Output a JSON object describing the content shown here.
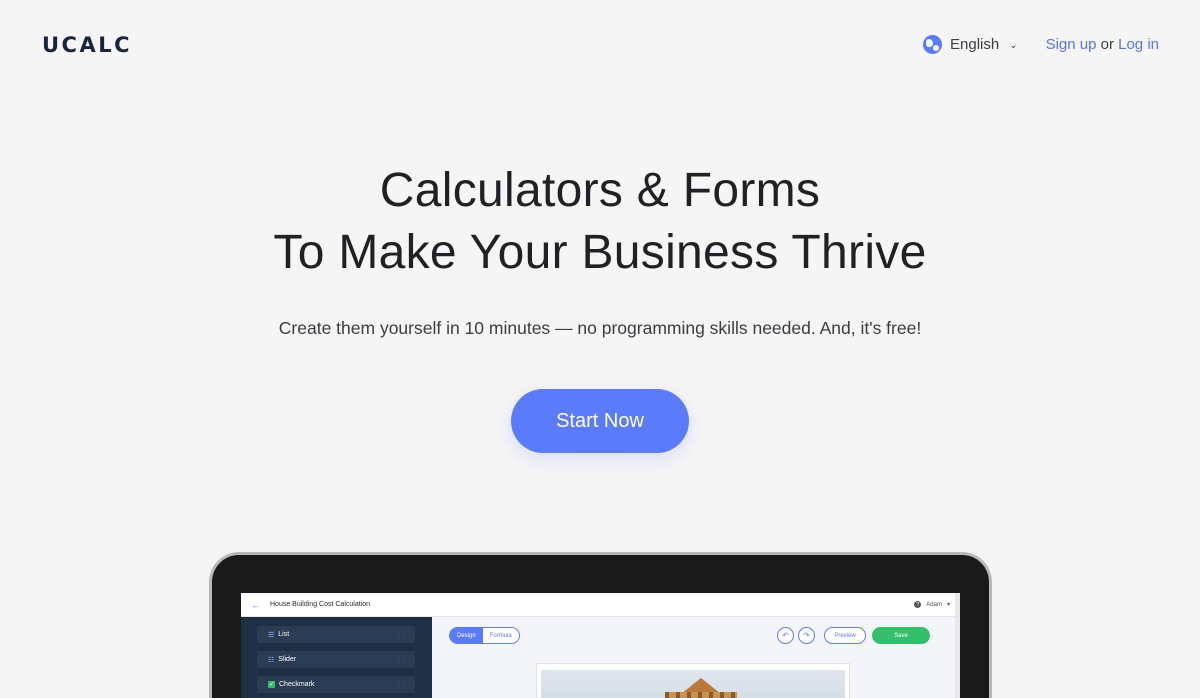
{
  "header": {
    "logo": "UCALC",
    "language": {
      "label": "English",
      "icon": "globe-icon"
    },
    "auth": {
      "signup": "Sign up",
      "or": "or",
      "login": "Log in"
    }
  },
  "hero": {
    "title_line1": "Calculators & Forms",
    "title_line2": "To Make Your Business Thrive",
    "subtitle": "Create them yourself in 10 minutes — no programming skills needed. And, it's free!",
    "cta": "Start Now"
  },
  "mockup": {
    "page_title": "House Building Cost Calculation",
    "user": "Adam",
    "sidebar_items": [
      {
        "label": "List",
        "icon": "list-icon"
      },
      {
        "label": "Slider",
        "icon": "slider-icon"
      },
      {
        "label": "Checkmark",
        "icon": "checkmark-icon"
      }
    ],
    "tabs": [
      "Design",
      "Formula"
    ],
    "preview": "Preview",
    "save": "Save"
  },
  "colors": {
    "accent": "#5b7cfa",
    "logo": "#18253a",
    "save": "#34c06b",
    "sidebar": "#1f2f44",
    "background": "#f5f5f5"
  }
}
